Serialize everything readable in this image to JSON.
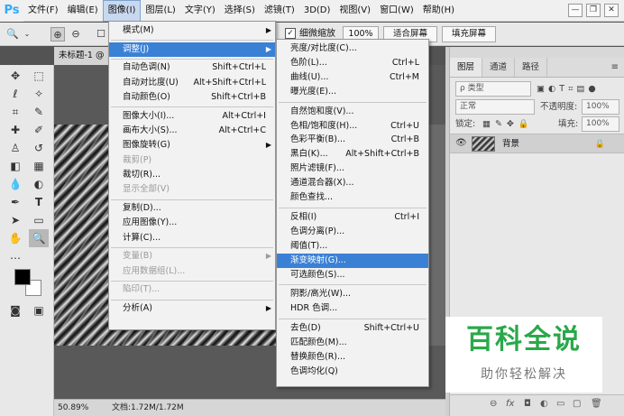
{
  "app": {
    "logo": "Ps"
  },
  "menubar": [
    {
      "label": "文件(F)",
      "key": "file"
    },
    {
      "label": "编辑(E)",
      "key": "edit"
    },
    {
      "label": "图像(I)",
      "key": "image"
    },
    {
      "label": "图层(L)",
      "key": "layer"
    },
    {
      "label": "文字(Y)",
      "key": "type"
    },
    {
      "label": "选择(S)",
      "key": "select"
    },
    {
      "label": "滤镜(T)",
      "key": "filter"
    },
    {
      "label": "3D(D)",
      "key": "3d"
    },
    {
      "label": "视图(V)",
      "key": "view"
    },
    {
      "label": "窗口(W)",
      "key": "window"
    },
    {
      "label": "帮助(H)",
      "key": "help"
    }
  ],
  "window_controls": {
    "minimize": "—",
    "restore": "❐",
    "close": "✕"
  },
  "options": {
    "scrubby_zoom_label": "细微缩放",
    "zoom_btn": "100%",
    "fit_screen": "适合屏幕",
    "fill_screen": "填充屏幕",
    "checked_mark": "✓"
  },
  "document": {
    "tab_title": "未标题-1 @",
    "zoom": "50.89%",
    "doc_info": "文档:1.72M/1.72M"
  },
  "layers_panel": {
    "tabs": [
      "图层",
      "通道",
      "路径"
    ],
    "kind_filter": "ρ 类型",
    "blend_mode": "正常",
    "opacity_label": "不透明度:",
    "opacity_value": "100%",
    "lock_label": "锁定:",
    "fill_label": "填充:",
    "fill_value": "100%",
    "layer_name": "背景"
  },
  "watermark": {
    "title": "百科全说",
    "subtitle": "助你轻松解决"
  },
  "image_menu": [
    {
      "label": "模式(M)",
      "shortcut": "",
      "arrow": true,
      "disabled": false
    },
    {
      "sep": true
    },
    {
      "label": "调整(J)",
      "shortcut": "",
      "arrow": true,
      "disabled": false,
      "highlight": true
    },
    {
      "sep": true
    },
    {
      "label": "自动色调(N)",
      "shortcut": "Shift+Ctrl+L"
    },
    {
      "label": "自动对比度(U)",
      "shortcut": "Alt+Shift+Ctrl+L"
    },
    {
      "label": "自动颜色(O)",
      "shortcut": "Shift+Ctrl+B"
    },
    {
      "sep": true
    },
    {
      "label": "图像大小(I)...",
      "shortcut": "Alt+Ctrl+I"
    },
    {
      "label": "画布大小(S)...",
      "shortcut": "Alt+Ctrl+C"
    },
    {
      "label": "图像旋转(G)",
      "shortcut": "",
      "arrow": true
    },
    {
      "label": "裁剪(P)",
      "shortcut": "",
      "disabled": true
    },
    {
      "label": "裁切(R)...",
      "shortcut": ""
    },
    {
      "label": "显示全部(V)",
      "shortcut": "",
      "disabled": true
    },
    {
      "sep": true
    },
    {
      "label": "复制(D)...",
      "shortcut": ""
    },
    {
      "label": "应用图像(Y)...",
      "shortcut": ""
    },
    {
      "label": "计算(C)...",
      "shortcut": ""
    },
    {
      "sep": true
    },
    {
      "label": "变量(B)",
      "shortcut": "",
      "arrow": true,
      "disabled": true
    },
    {
      "label": "应用数据组(L)...",
      "shortcut": "",
      "disabled": true
    },
    {
      "sep": true
    },
    {
      "label": "陷印(T)...",
      "shortcut": "",
      "disabled": true
    },
    {
      "sep": true
    },
    {
      "label": "分析(A)",
      "shortcut": "",
      "arrow": true
    }
  ],
  "adjust_menu": [
    {
      "label": "亮度/对比度(C)...",
      "shortcut": ""
    },
    {
      "label": "色阶(L)...",
      "shortcut": "Ctrl+L"
    },
    {
      "label": "曲线(U)...",
      "shortcut": "Ctrl+M"
    },
    {
      "label": "曝光度(E)...",
      "shortcut": ""
    },
    {
      "sep": true
    },
    {
      "label": "自然饱和度(V)...",
      "shortcut": ""
    },
    {
      "label": "色相/饱和度(H)...",
      "shortcut": "Ctrl+U"
    },
    {
      "label": "色彩平衡(B)...",
      "shortcut": "Ctrl+B"
    },
    {
      "label": "黑白(K)...",
      "shortcut": "Alt+Shift+Ctrl+B"
    },
    {
      "label": "照片滤镜(F)...",
      "shortcut": ""
    },
    {
      "label": "通道混合器(X)...",
      "shortcut": ""
    },
    {
      "label": "颜色查找...",
      "shortcut": ""
    },
    {
      "sep": true
    },
    {
      "label": "反相(I)",
      "shortcut": "Ctrl+I"
    },
    {
      "label": "色调分离(P)...",
      "shortcut": ""
    },
    {
      "label": "阈值(T)...",
      "shortcut": ""
    },
    {
      "label": "渐变映射(G)...",
      "shortcut": "",
      "highlight": true
    },
    {
      "label": "可选颜色(S)...",
      "shortcut": ""
    },
    {
      "sep": true
    },
    {
      "label": "阴影/高光(W)...",
      "shortcut": ""
    },
    {
      "label": "HDR 色调...",
      "shortcut": ""
    },
    {
      "sep": true
    },
    {
      "label": "去色(D)",
      "shortcut": "Shift+Ctrl+U"
    },
    {
      "label": "匹配颜色(M)...",
      "shortcut": ""
    },
    {
      "label": "替换颜色(R)...",
      "shortcut": ""
    },
    {
      "label": "色调均化(Q)",
      "shortcut": ""
    }
  ],
  "colors": {
    "highlight": "#3a81d6",
    "watermark_green": "#2aa84a",
    "menu_bg": "#f2f2f2"
  }
}
